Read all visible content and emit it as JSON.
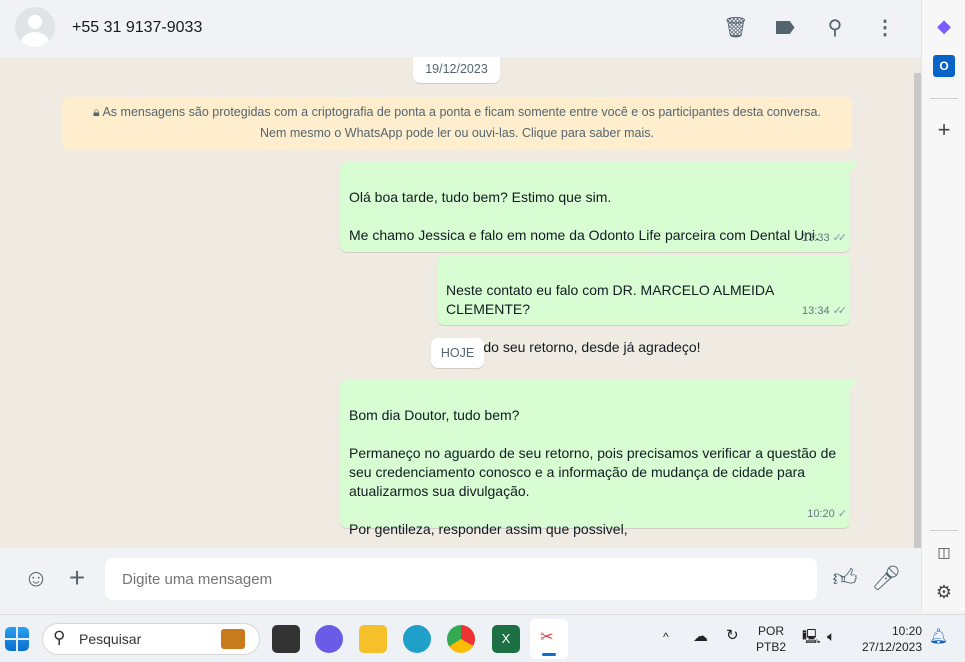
{
  "header": {
    "contact": "+55 31 9137-9033",
    "icons": [
      "archive-icon",
      "label-icon",
      "search-icon",
      "menu-icon"
    ]
  },
  "chat": {
    "date_chip": "19/12/2023",
    "encryption_notice": "As mensagens são protegidas com a criptografia de ponta a ponta e ficam somente entre você e os participantes desta conversa. Nem mesmo o WhatsApp pode ler ou ouvi-las. Clique para saber mais.",
    "today_chip": "HOJE",
    "messages": [
      {
        "text": "Olá boa tarde, tudo bem? Estimo que sim.\n\nMe chamo Jessica e falo em nome da Odonto Life parceira com Dental Uni.",
        "time": "13:33",
        "status": "read"
      },
      {
        "text": "Neste contato eu falo com DR. MARCELO ALMEIDA CLEMENTE?\n\nAguardo seu retorno, desde já agradeço!",
        "time": "13:34",
        "status": "read"
      },
      {
        "text": "Bom dia Doutor, tudo bem?\n\nPermaneço no aguardo de seu retorno, pois precisamos verificar a questão de seu credenciamento conosco e a informação de mudança de cidade para atualizarmos sua divulgação.\n\nPor gentileza, responder assim que possivel,",
        "time": "10:20",
        "status": "sent"
      }
    ]
  },
  "footer": {
    "placeholder": "Digite uma mensagem"
  },
  "taskbar": {
    "search": "Pesquisar",
    "lang1": "POR",
    "lang2": "PTB2",
    "time": "10:20",
    "date": "27/12/2023"
  },
  "colors": {
    "bubble": "#d9fdd3",
    "bg": "#efeae2",
    "notice": "#ffeecd"
  }
}
